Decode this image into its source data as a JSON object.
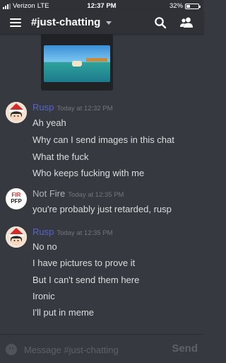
{
  "status_bar": {
    "carrier": "Verizon",
    "network": "LTE",
    "time": "12:37 PM",
    "battery": "32%",
    "battery_level": 0.32
  },
  "header": {
    "channel": "#just-chatting"
  },
  "colors": {
    "background": "#36393f",
    "header": "#2f3136",
    "rusp_name": "#5865c9",
    "notfire_name": "#b0b3b8",
    "timestamp": "#72767d"
  },
  "messages": [
    {
      "author": "Rusp",
      "timestamp": "Today at 12:32 PM",
      "lines": [
        "Ah yeah",
        "Why can I send images in this chat",
        "What the fuck",
        "Who keeps fucking with me"
      ]
    },
    {
      "author": "Not Fire",
      "timestamp": "Today at 12:35 PM",
      "avatar_text": [
        "FIR",
        "PFP"
      ],
      "lines": [
        "you're probably just retarded, rusp"
      ]
    },
    {
      "author": "Rusp",
      "timestamp": "Today at 12:35 PM",
      "lines": [
        "No no",
        "I have pictures to prove it",
        "But I can't send them here",
        "Ironic",
        "I'll put in meme"
      ]
    }
  ],
  "composer": {
    "placeholder": "Message #just-chatting",
    "send_label": "Send"
  },
  "icons": {
    "menu": "hamburger-menu-icon",
    "search": "search-icon",
    "members": "members-icon",
    "emoji": "emoji-icon"
  }
}
